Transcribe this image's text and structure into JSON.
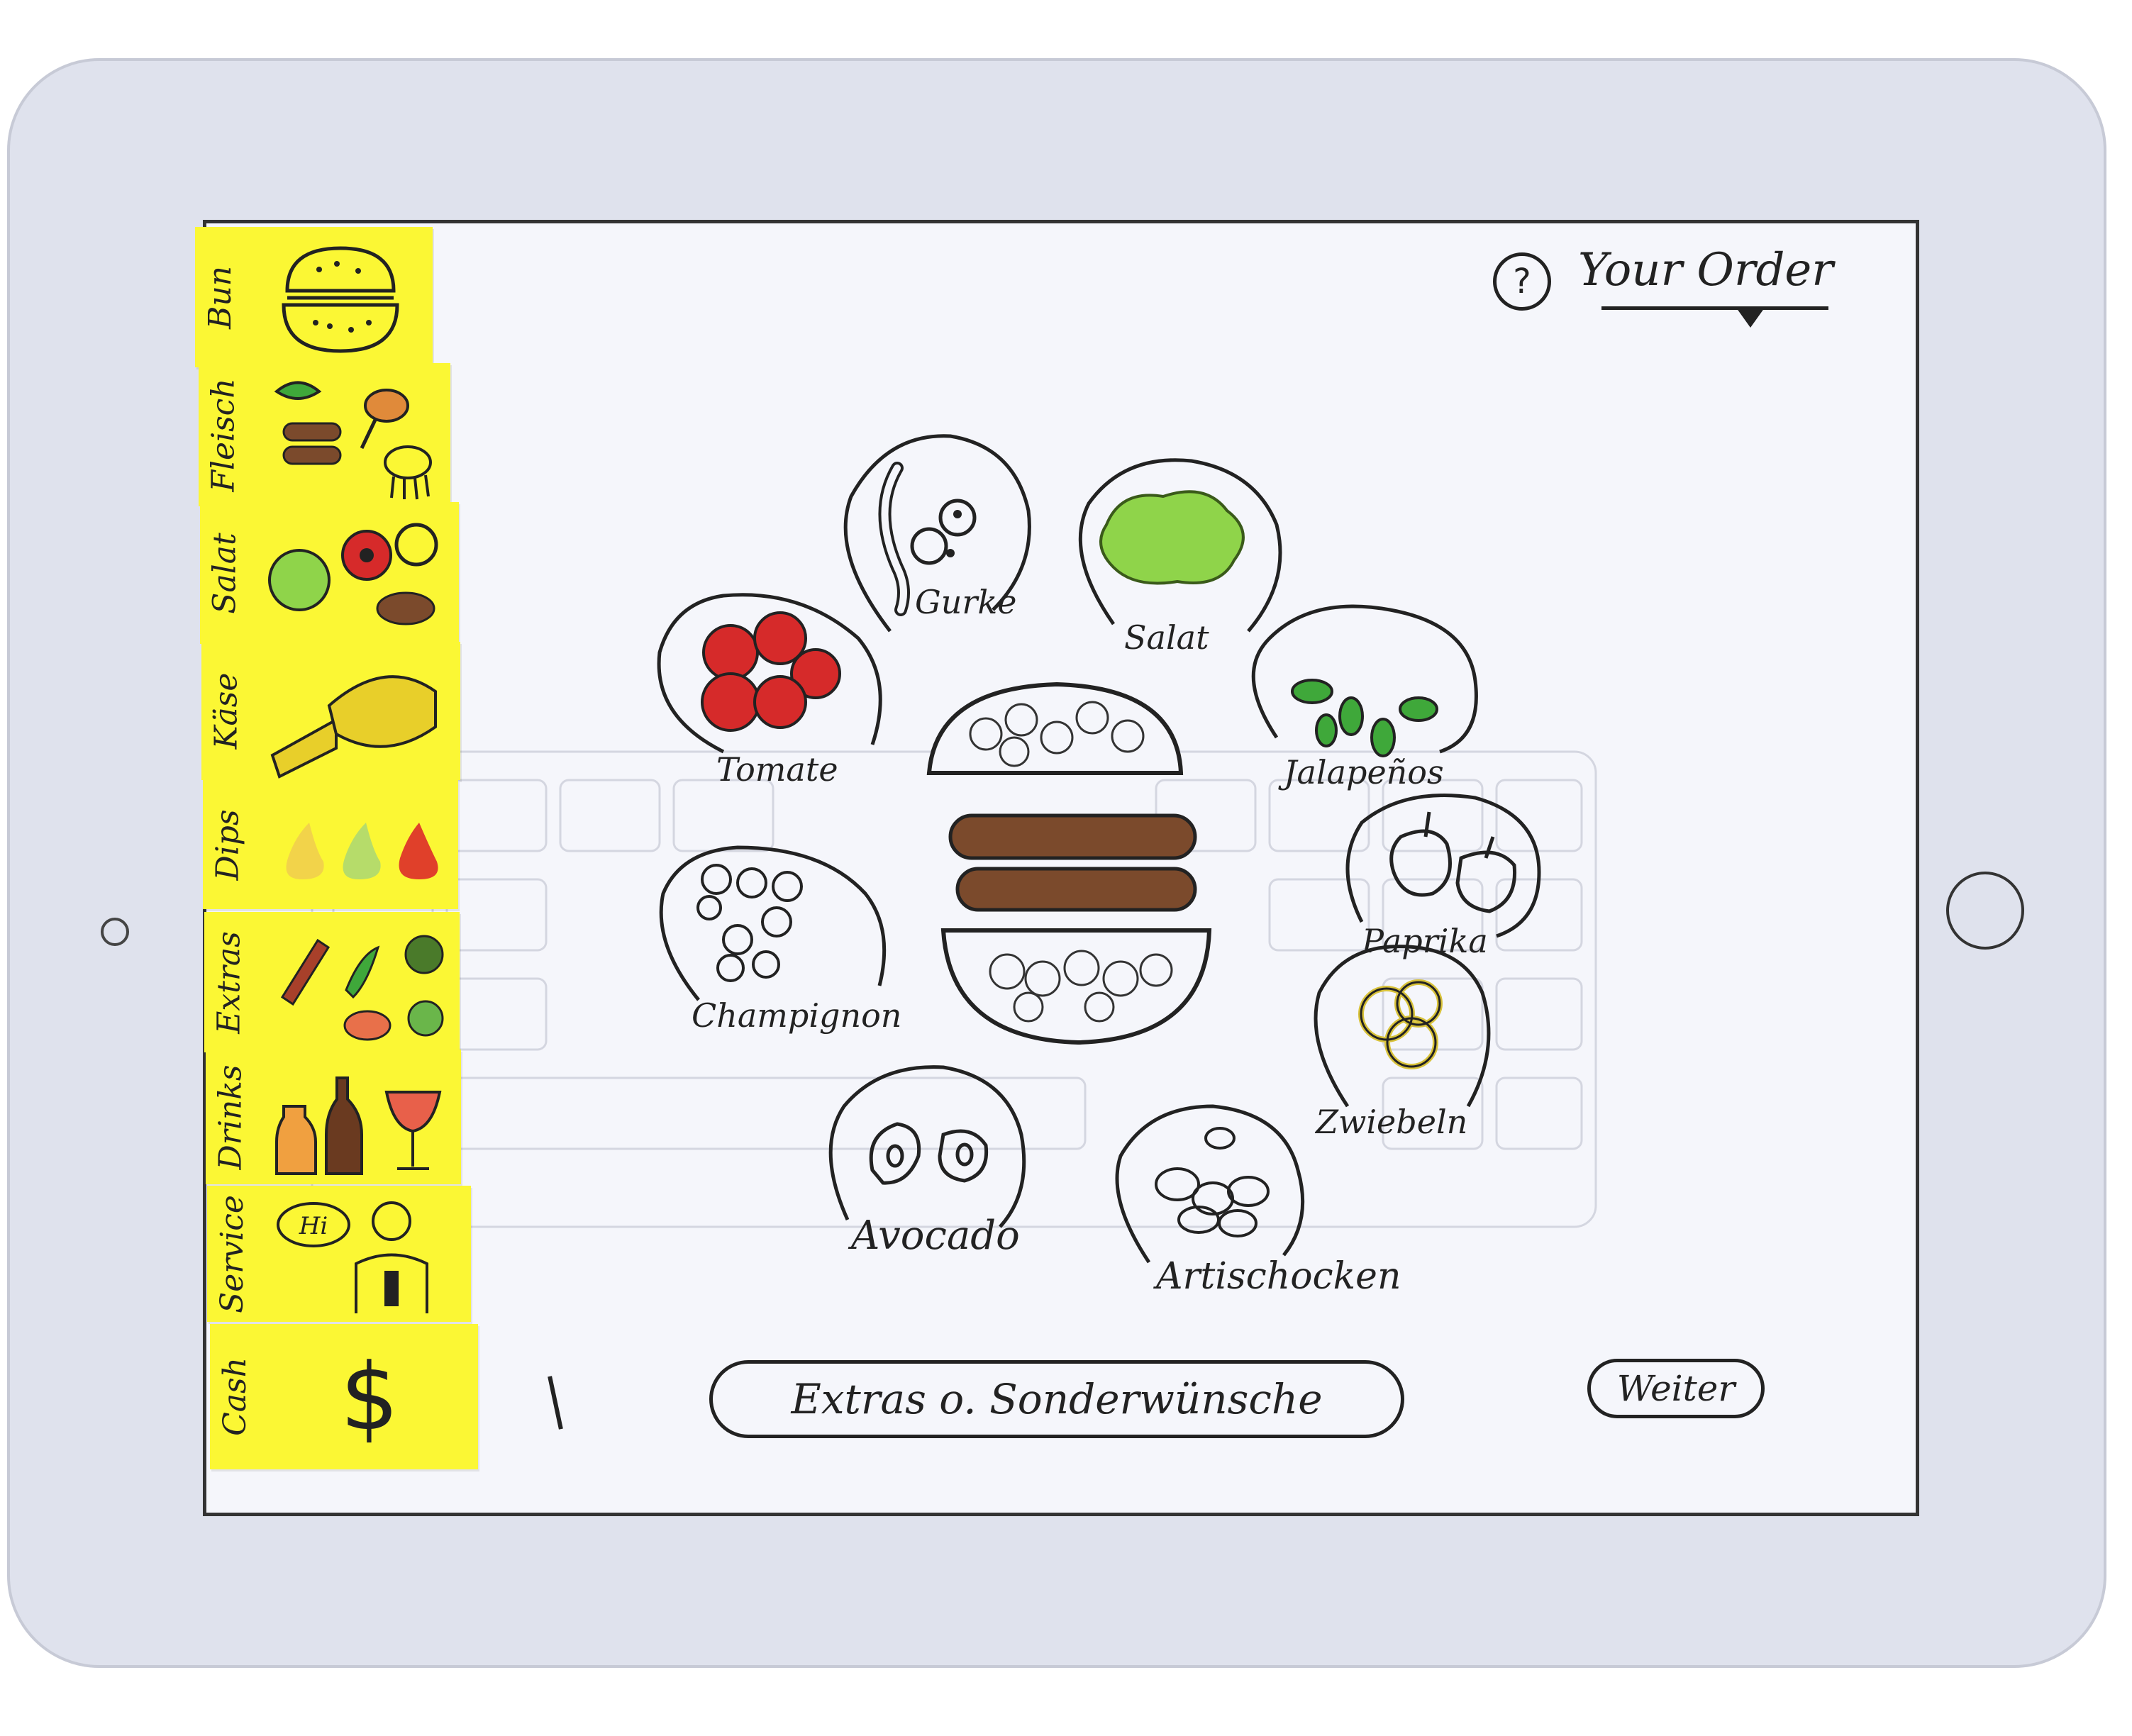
{
  "sidebar": {
    "tabs": [
      {
        "label": "Bun",
        "icon": "bun-icon"
      },
      {
        "label": "Fleisch",
        "icon": "meat-icon"
      },
      {
        "label": "Salat",
        "icon": "salad-icon"
      },
      {
        "label": "Käse",
        "icon": "cheese-icon"
      },
      {
        "label": "Dips",
        "icon": "dips-icon"
      },
      {
        "label": "Extras",
        "icon": "extras-icon"
      },
      {
        "label": "Drinks",
        "icon": "drinks-icon"
      },
      {
        "label": "Service",
        "icon": "service-icon",
        "speech": "Hi"
      },
      {
        "label": "Cash",
        "icon": "dollar-icon",
        "symbol": "$"
      }
    ]
  },
  "header": {
    "help_symbol": "?",
    "your_order": "Your Order"
  },
  "toppings": [
    {
      "label": "Gurke",
      "icon": "cucumber-icon"
    },
    {
      "label": "Salat",
      "icon": "lettuce-icon"
    },
    {
      "label": "Tomate",
      "icon": "tomato-icon"
    },
    {
      "label": "Jalapeños",
      "icon": "jalapeno-icon"
    },
    {
      "label": "Paprika",
      "icon": "paprika-icon"
    },
    {
      "label": "Champignon",
      "icon": "mushroom-icon"
    },
    {
      "label": "Zwiebeln",
      "icon": "onion-icon"
    },
    {
      "label": "Avocado",
      "icon": "avocado-icon"
    },
    {
      "label": "Artischocken",
      "icon": "artichoke-icon"
    }
  ],
  "footer": {
    "extras_button": "Extras o. Sonderwünsche",
    "next_button": "Weiter"
  },
  "colors": {
    "sticky": "#fbf734",
    "tomato": "#d62a2a",
    "lettuce": "#8fd44a",
    "patty": "#7b4a2c",
    "onion": "#d8c23a",
    "jalapeno": "#3fa83a"
  }
}
